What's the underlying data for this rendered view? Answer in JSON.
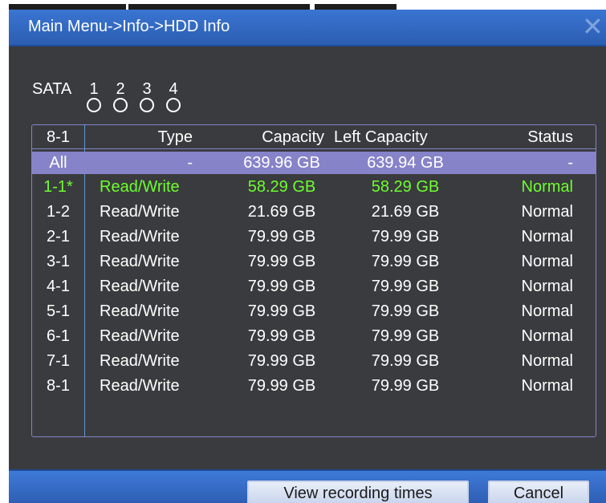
{
  "window": {
    "title": "Main Menu->Info->HDD Info",
    "close_glyph": "✕"
  },
  "sata": {
    "label": "SATA",
    "ports": [
      "1",
      "2",
      "3",
      "4"
    ],
    "indicator": "circle-empty"
  },
  "table": {
    "headers": {
      "id": "8-1",
      "type": "Type",
      "capacity": "Capacity",
      "left_capacity": "Left Capacity",
      "status": "Status"
    },
    "rows": [
      {
        "id": "All",
        "type": "-",
        "capacity": "639.96 GB",
        "left": "639.94 GB",
        "status": "-",
        "state": "selected"
      },
      {
        "id": "1-1*",
        "type": "Read/Write",
        "capacity": "58.29 GB",
        "left": "58.29 GB",
        "status": "Normal",
        "state": "current"
      },
      {
        "id": "1-2",
        "type": "Read/Write",
        "capacity": "21.69 GB",
        "left": "21.69 GB",
        "status": "Normal",
        "state": "normal"
      },
      {
        "id": "2-1",
        "type": "Read/Write",
        "capacity": "79.99 GB",
        "left": "79.99 GB",
        "status": "Normal",
        "state": "normal"
      },
      {
        "id": "3-1",
        "type": "Read/Write",
        "capacity": "79.99 GB",
        "left": "79.99 GB",
        "status": "Normal",
        "state": "normal"
      },
      {
        "id": "4-1",
        "type": "Read/Write",
        "capacity": "79.99 GB",
        "left": "79.99 GB",
        "status": "Normal",
        "state": "normal"
      },
      {
        "id": "5-1",
        "type": "Read/Write",
        "capacity": "79.99 GB",
        "left": "79.99 GB",
        "status": "Normal",
        "state": "normal"
      },
      {
        "id": "6-1",
        "type": "Read/Write",
        "capacity": "79.99 GB",
        "left": "79.99 GB",
        "status": "Normal",
        "state": "normal"
      },
      {
        "id": "7-1",
        "type": "Read/Write",
        "capacity": "79.99 GB",
        "left": "79.99 GB",
        "status": "Normal",
        "state": "normal"
      },
      {
        "id": "8-1",
        "type": "Read/Write",
        "capacity": "79.99 GB",
        "left": "79.99 GB",
        "status": "Normal",
        "state": "normal"
      }
    ]
  },
  "buttons": {
    "view_recording_times": "View recording times",
    "cancel": "Cancel"
  },
  "colors": {
    "title_bar": "#2f63bd",
    "panel_bg": "#3a3b3e",
    "selected_row": "#8783c9",
    "current_row_text": "#6dff2f",
    "table_border": "#7f86c9"
  }
}
